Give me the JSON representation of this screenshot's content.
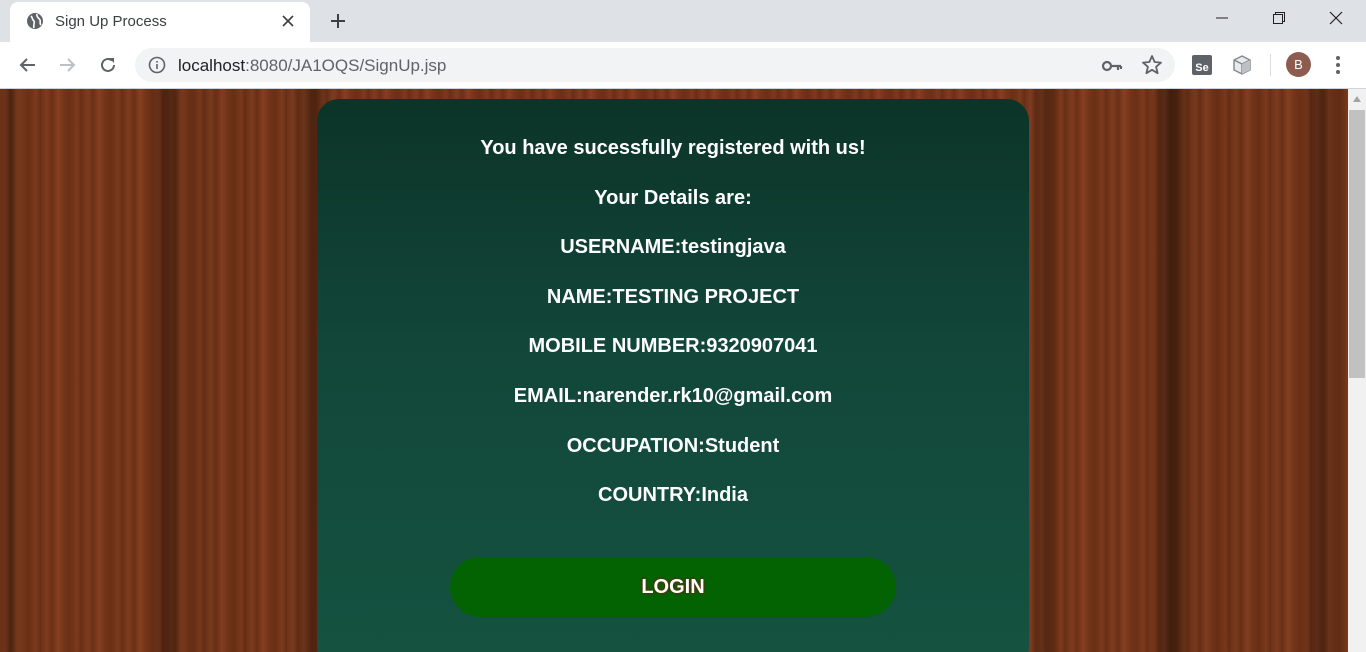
{
  "browser": {
    "tab_title": "Sign Up Process",
    "url_host": "localhost",
    "url_rest": ":8080/JA1OQS/SignUp.jsp",
    "avatar_letter": "B",
    "extension_se_label": "Se"
  },
  "page": {
    "success_message": "You have sucessfully registered with us!",
    "details_heading": "Your Details are:",
    "username": "USERNAME:testingjava",
    "name": "NAME:TESTING PROJECT",
    "mobile": "MOBILE NUMBER:9320907041",
    "email": "EMAIL:narender.rk10@gmail.com",
    "occupation": "OCCUPATION:Student",
    "country": "COUNTRY:India",
    "login_label": "LOGIN"
  },
  "icons": {
    "favicon": "globe-icon",
    "tab_close": "close-icon",
    "new_tab": "plus-icon",
    "back": "arrow-left-icon",
    "forward": "arrow-right-icon",
    "reload": "reload-icon",
    "site_info": "info-icon",
    "password": "key-icon",
    "bookmark": "star-icon",
    "selenium_ext": "selenium-icon",
    "cube_ext": "cube-icon",
    "menu": "kebab-menu-icon"
  },
  "colors": {
    "card_top": "#0c3428",
    "card_bottom": "#155340",
    "login_button": "#036303",
    "wood": "#72361b",
    "text": "#ffffff"
  }
}
